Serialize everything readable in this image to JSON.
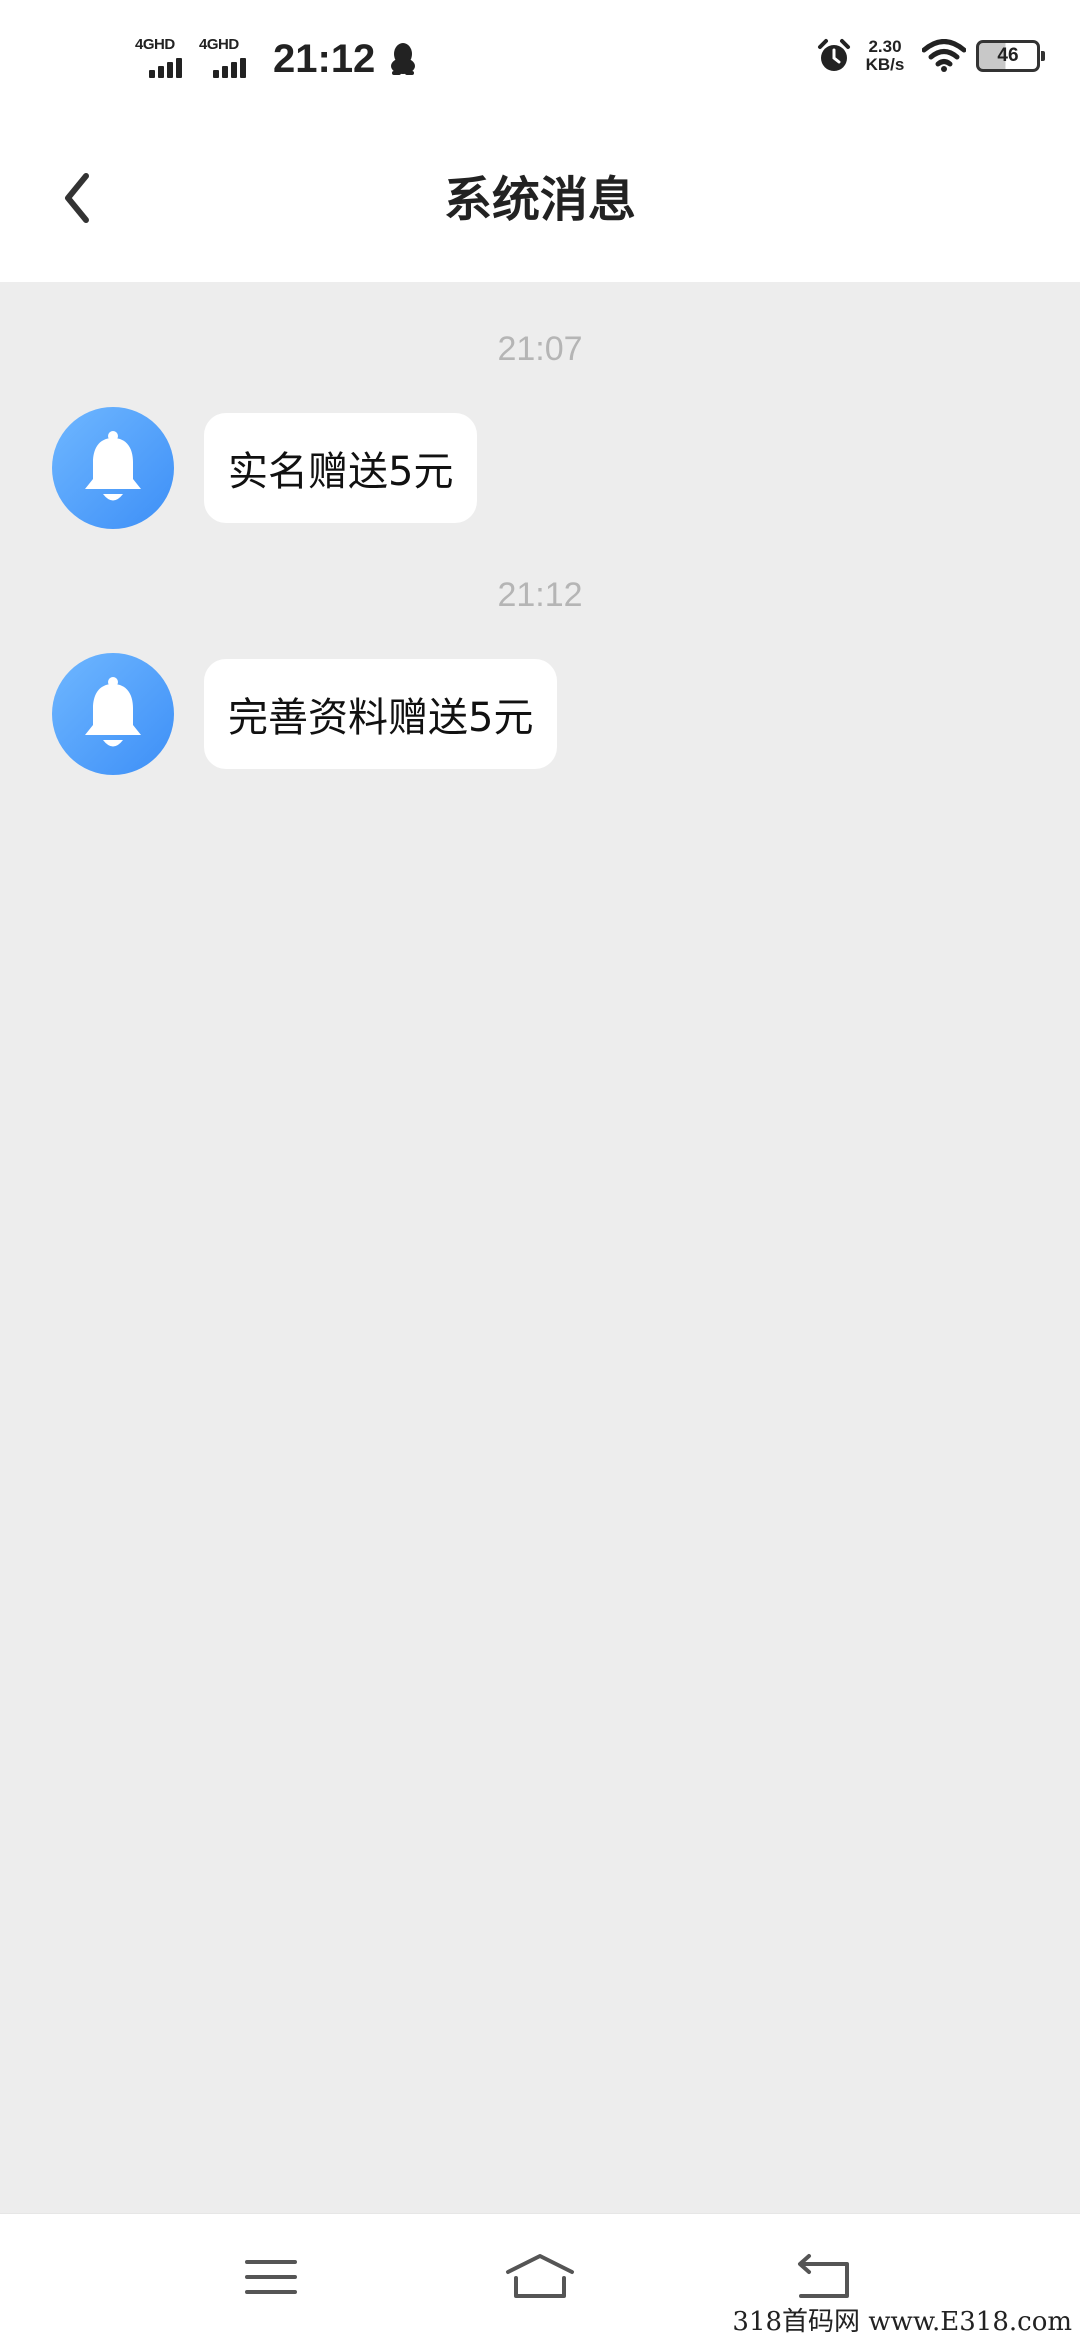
{
  "status_bar": {
    "network_1": "4GHD",
    "network_2": "4GHD",
    "time": "21:12",
    "speed_value": "2.30",
    "speed_unit": "KB/s",
    "battery_level": "46",
    "icons": [
      "signal-icon",
      "qq-icon",
      "alarm-icon",
      "wifi-icon",
      "battery-icon"
    ]
  },
  "nav": {
    "title": "系统消息",
    "back_icon": "chevron-left-icon"
  },
  "messages": [
    {
      "time": "21:07",
      "text": "实名赠送5元",
      "avatar_icon": "bell-icon"
    },
    {
      "time": "21:12",
      "text": "完善资料赠送5元",
      "avatar_icon": "bell-icon"
    }
  ],
  "bottom_bar": {
    "icons": [
      "menu-icon",
      "home-icon",
      "back-icon"
    ]
  },
  "watermark": "318首码网  www.E318.com",
  "colors": {
    "background": "#ededed",
    "avatar_blue": "#4a9bf8",
    "time_label": "#b5b5b5"
  }
}
